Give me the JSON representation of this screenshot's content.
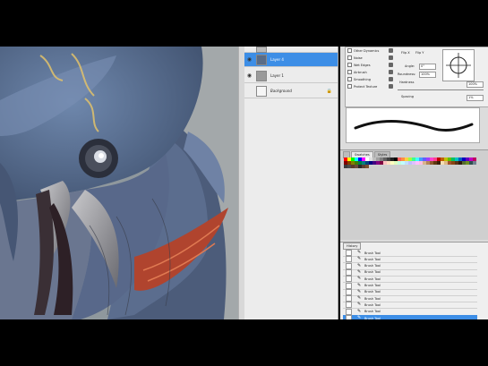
{
  "layers": [
    {
      "name": "",
      "selected": false,
      "italic": false,
      "visible": true
    },
    {
      "name": "Layer 4",
      "selected": true,
      "italic": false,
      "visible": true
    },
    {
      "name": "Layer 1",
      "selected": false,
      "italic": false,
      "visible": true
    },
    {
      "name": "Background",
      "selected": false,
      "italic": true,
      "visible": false
    }
  ],
  "brushes": {
    "options": [
      "Other Dynamics",
      "Noise",
      "Wet Edges",
      "Airbrush",
      "Smoothing",
      "Protect Texture"
    ],
    "flip_x": "Flip X",
    "flip_y": "Flip Y",
    "angle_label": "Angle:",
    "angle_value": "0°",
    "roundness_label": "Roundness:",
    "roundness_value": "100%",
    "hardness_label": "Hardness",
    "hardness_value": "100%",
    "spacing_label": "Spacing",
    "spacing_value": "1%"
  },
  "swatches_panel": {
    "tabs": [
      "",
      "Swatches",
      "Styles"
    ],
    "active_tab": 1,
    "colors": [
      "#ff0000",
      "#ffff00",
      "#00ff00",
      "#00ffff",
      "#0000ff",
      "#ff00ff",
      "#ffffff",
      "#e0e0e0",
      "#c0c0c0",
      "#a0a0a0",
      "#808080",
      "#606060",
      "#404040",
      "#202020",
      "#000000",
      "#ff6060",
      "#ff9040",
      "#ffd040",
      "#a0ff40",
      "#40ff90",
      "#40ffff",
      "#40a0ff",
      "#6060ff",
      "#a040ff",
      "#ff40d0",
      "#ff4090",
      "#c00000",
      "#c06000",
      "#c0c000",
      "#60c000",
      "#00c060",
      "#00c0c0",
      "#0060c0",
      "#0000c0",
      "#6000c0",
      "#c000c0",
      "#c00060"
    ],
    "colors_row3": [
      "#800000",
      "#804000",
      "#808000",
      "#408000",
      "#008040",
      "#008080",
      "#004080",
      "#000080",
      "#400080",
      "#800080",
      "#800040",
      "#ffc0c0",
      "#ffe0c0",
      "#ffffc0",
      "#e0ffc0",
      "#c0ffe0",
      "#c0ffff",
      "#c0e0ff",
      "#c0c0ff",
      "#e0c0ff",
      "#ffc0ff",
      "#ffc0e0",
      "#d9b38c",
      "#b38659",
      "#8c5a2d",
      "#603810",
      "#3a2007",
      "#f5deb3",
      "#deb887",
      "#a0522d",
      "#8b4513",
      "#5c3317",
      "#2e1a0c",
      "#556b2f",
      "#6b8e23",
      "#2f4f4f",
      "#708090"
    ],
    "colors_row4": [
      "#3b3b3b",
      "#4a4a4a",
      "#5a3a2a",
      "#6a4a3a",
      "#2a2a2a",
      "#5c4033",
      "#7a5230"
    ]
  },
  "history": {
    "tab": "History",
    "items": [
      "Brush Tool",
      "Brush Tool",
      "Brush Tool",
      "Brush Tool",
      "Brush Tool",
      "Brush Tool",
      "Brush Tool",
      "Brush Tool",
      "Brush Tool",
      "Brush Tool",
      "Brush Tool"
    ],
    "selected_index": 10
  }
}
